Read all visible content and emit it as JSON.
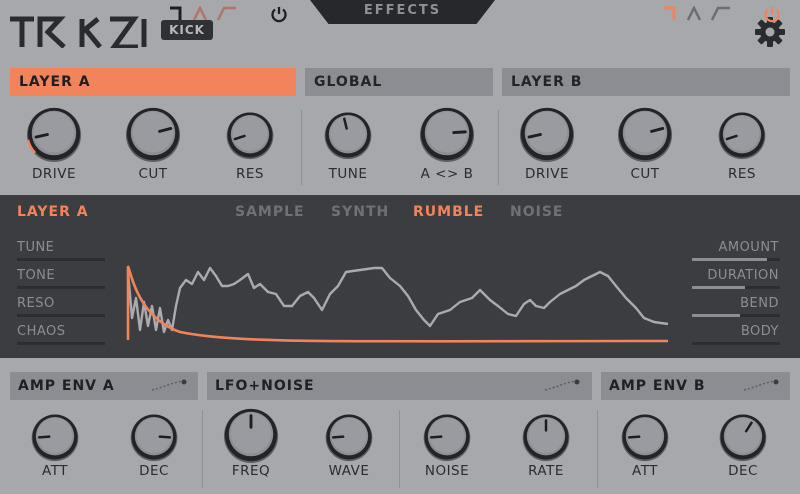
{
  "header": {
    "tab_label": "EFFECTS",
    "logo_text": "TRK 01",
    "badge": "KICK"
  },
  "layer_a": {
    "title": "LAYER A",
    "knobs": [
      {
        "label": "DRIVE",
        "value": 0.12
      },
      {
        "label": "CUT",
        "value": 0.78
      },
      {
        "label": "RES",
        "value": 0.1
      }
    ]
  },
  "global": {
    "title": "GLOBAL",
    "knobs": [
      {
        "label": "TUNE",
        "value": 0.45
      },
      {
        "label": "A <> B",
        "value": 0.82
      }
    ]
  },
  "layer_b": {
    "title": "LAYER B",
    "knobs": [
      {
        "label": "DRIVE",
        "value": 0.12
      },
      {
        "label": "CUT",
        "value": 0.78
      },
      {
        "label": "RES",
        "value": 0.1
      }
    ]
  },
  "editor": {
    "layer_title": "LAYER A",
    "tabs": [
      "SAMPLE",
      "SYNTH",
      "RUMBLE",
      "NOISE"
    ],
    "active_tab": "RUMBLE",
    "left_params": [
      {
        "label": "TUNE",
        "value": 0.0
      },
      {
        "label": "TONE",
        "value": 0.0
      },
      {
        "label": "RESO",
        "value": 0.0
      },
      {
        "label": "CHAOS",
        "value": 0.0
      }
    ],
    "right_params": [
      {
        "label": "AMOUNT",
        "value": 0.85
      },
      {
        "label": "DURATION",
        "value": 0.6
      },
      {
        "label": "BEND",
        "value": 0.55
      },
      {
        "label": "BODY",
        "value": 0.0
      }
    ]
  },
  "amp_env_a": {
    "title": "AMP ENV A",
    "knobs": [
      {
        "label": "ATT",
        "value": 0.15
      },
      {
        "label": "DEC",
        "value": 0.85
      }
    ]
  },
  "lfo_noise": {
    "title": "LFO+NOISE",
    "knobs": [
      {
        "label": "FREQ",
        "value": 0.5
      },
      {
        "label": "WAVE",
        "value": 0.15
      },
      {
        "label": "NOISE",
        "value": 0.15
      },
      {
        "label": "RATE",
        "value": 0.5
      }
    ]
  },
  "amp_env_b": {
    "title": "AMP ENV B",
    "knobs": [
      {
        "label": "ATT",
        "value": 0.15
      },
      {
        "label": "DEC",
        "value": 0.62
      }
    ]
  },
  "colors": {
    "accent": "#f2845c",
    "panel": "#a6a8ac",
    "dark_panel": "#3b3d41",
    "header_bar": "#8b8d92"
  }
}
